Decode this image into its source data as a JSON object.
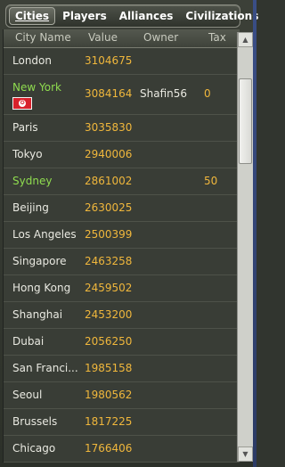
{
  "tabs": [
    {
      "label": "Cities",
      "active": true
    },
    {
      "label": "Players",
      "active": false
    },
    {
      "label": "Alliances",
      "active": false
    },
    {
      "label": "Civilizations",
      "active": false
    }
  ],
  "columns": {
    "city_name": "City Name",
    "value": "Value",
    "owner": "Owner",
    "tax": "Tax"
  },
  "rows": [
    {
      "name": "London",
      "value": "3104675",
      "owner": "",
      "tax": ""
    },
    {
      "name": "New York",
      "value": "3084164",
      "owner": "Shafin56",
      "tax": "0",
      "highlight": true,
      "flag": "flag-icon"
    },
    {
      "name": "Paris",
      "value": "3035830",
      "owner": "",
      "tax": ""
    },
    {
      "name": "Tokyo",
      "value": "2940006",
      "owner": "",
      "tax": ""
    },
    {
      "name": "Sydney",
      "value": "2861002",
      "owner": "",
      "tax": "50",
      "highlight": true
    },
    {
      "name": "Beijing",
      "value": "2630025",
      "owner": "",
      "tax": ""
    },
    {
      "name": "Los Angeles",
      "value": "2500399",
      "owner": "",
      "tax": ""
    },
    {
      "name": "Singapore",
      "value": "2463258",
      "owner": "",
      "tax": ""
    },
    {
      "name": "Hong Kong",
      "value": "2459502",
      "owner": "",
      "tax": ""
    },
    {
      "name": "Shanghai",
      "value": "2453200",
      "owner": "",
      "tax": ""
    },
    {
      "name": "Dubai",
      "value": "2056250",
      "owner": "",
      "tax": ""
    },
    {
      "name": "San Franci...",
      "value": "1985158",
      "owner": "",
      "tax": ""
    },
    {
      "name": "Seoul",
      "value": "1980562",
      "owner": "",
      "tax": ""
    },
    {
      "name": "Brussels",
      "value": "1817225",
      "owner": "",
      "tax": ""
    },
    {
      "name": "Chicago",
      "value": "1766406",
      "owner": "",
      "tax": ""
    }
  ],
  "colors": {
    "highlight_name": "#8fdc4f",
    "value_text": "#f0b73c",
    "background": "#393d36"
  },
  "icons": {
    "scroll_up": "triangle-up-icon",
    "scroll_down": "triangle-down-icon"
  }
}
